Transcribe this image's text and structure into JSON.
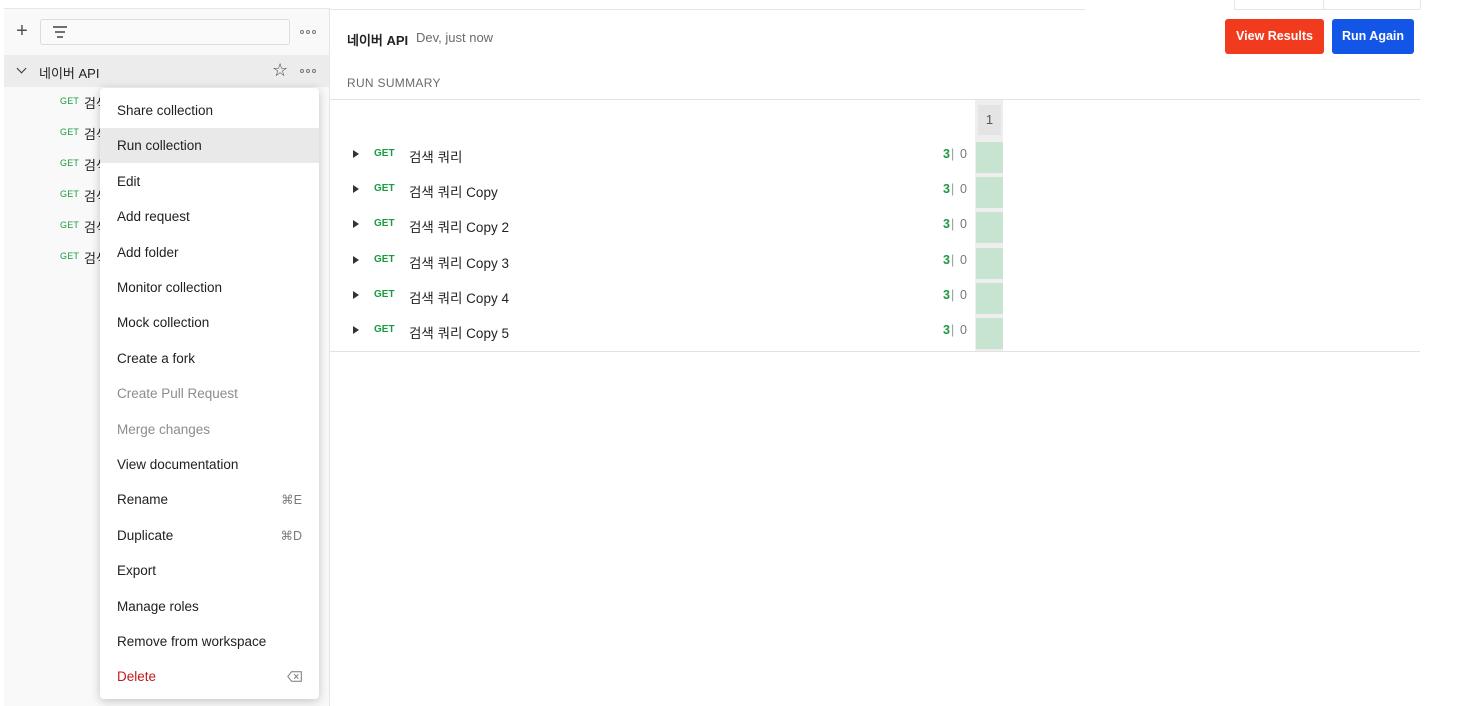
{
  "sidebar": {
    "new_icon": "plus-icon",
    "filter_icon": "filter-icon",
    "more_icon": "more-icon",
    "collection": {
      "name": "네이버 API",
      "expand_icon": "chevron-down-icon",
      "star_icon": "star-icon"
    },
    "requests": [
      {
        "method": "GET",
        "name": "검색"
      },
      {
        "method": "GET",
        "name": "검색"
      },
      {
        "method": "GET",
        "name": "검색"
      },
      {
        "method": "GET",
        "name": "검색"
      },
      {
        "method": "GET",
        "name": "검색"
      },
      {
        "method": "GET",
        "name": "검색"
      }
    ]
  },
  "context_menu": {
    "items": [
      {
        "label": "Share collection",
        "state": "normal"
      },
      {
        "label": "Run collection",
        "state": "active"
      },
      {
        "label": "Edit",
        "state": "normal"
      },
      {
        "label": "Add request",
        "state": "normal"
      },
      {
        "label": "Add folder",
        "state": "normal"
      },
      {
        "label": "Monitor collection",
        "state": "normal"
      },
      {
        "label": "Mock collection",
        "state": "normal"
      },
      {
        "label": "Create a fork",
        "state": "normal"
      },
      {
        "label": "Create Pull Request",
        "state": "disabled"
      },
      {
        "label": "Merge changes",
        "state": "disabled"
      },
      {
        "label": "View documentation",
        "state": "normal"
      },
      {
        "label": "Rename",
        "state": "normal",
        "shortcut": "⌘E"
      },
      {
        "label": "Duplicate",
        "state": "normal",
        "shortcut": "⌘D"
      },
      {
        "label": "Export",
        "state": "normal"
      },
      {
        "label": "Manage roles",
        "state": "normal"
      },
      {
        "label": "Remove from workspace",
        "state": "normal"
      },
      {
        "label": "Delete",
        "state": "danger",
        "shortcut_icon": "backspace-icon"
      }
    ]
  },
  "run": {
    "title": "네이버 API",
    "meta": "Dev, just now",
    "view_results_label": "View Results",
    "run_again_label": "Run Again",
    "summary_label": "RUN SUMMARY",
    "iteration_header": "1",
    "rows": [
      {
        "method": "GET",
        "name": "검색 쿼리",
        "passed": "3",
        "separator": "|",
        "failed": "0"
      },
      {
        "method": "GET",
        "name": "검색 쿼리 Copy",
        "passed": "3",
        "separator": "|",
        "failed": "0"
      },
      {
        "method": "GET",
        "name": "검색 쿼리 Copy 2",
        "passed": "3",
        "separator": "|",
        "failed": "0"
      },
      {
        "method": "GET",
        "name": "검색 쿼리 Copy 3",
        "passed": "3",
        "separator": "|",
        "failed": "0"
      },
      {
        "method": "GET",
        "name": "검색 쿼리 Copy 4",
        "passed": "3",
        "separator": "|",
        "failed": "0"
      },
      {
        "method": "GET",
        "name": "검색 쿼리 Copy 5",
        "passed": "3",
        "separator": "|",
        "failed": "0"
      }
    ]
  },
  "colors": {
    "view_results": "#f23a1e",
    "run_again": "#1355e6",
    "get_method": "#1a9b3f",
    "pass_cell": "#c7e4d0",
    "danger": "#c4191b"
  }
}
